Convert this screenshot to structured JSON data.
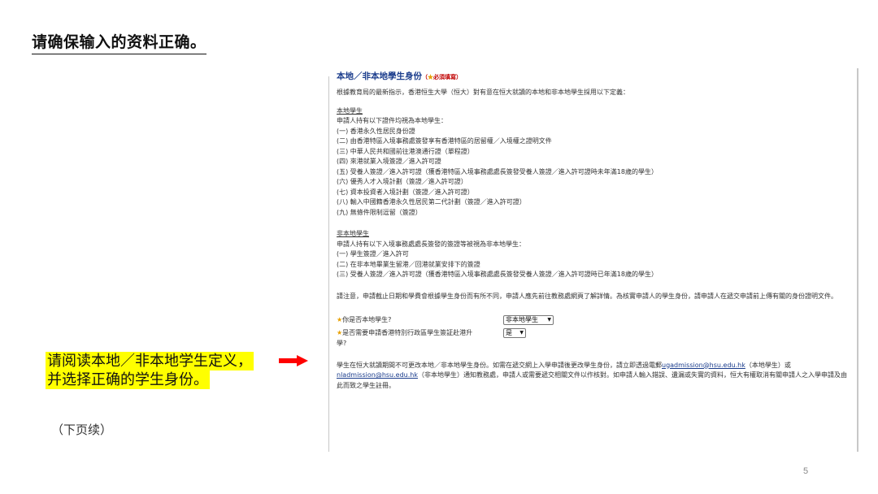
{
  "slide": {
    "title": "请确保输入的资料正确。",
    "instruction_lines": [
      "请阅读本地／非本地学生定义，",
      "并选择正确的学生身份。"
    ],
    "continued": "（下页续）",
    "page_number": "5",
    "arrow_color": "#ff0000",
    "highlight_color": "#ffff00"
  },
  "form": {
    "section_title": "本地／非本地學生身份",
    "required_note": "必須填寫",
    "intro": "根據教育局的最新指示，香港恒生大學（恒大）對有意在恒大就讀的本地和非本地學生採用以下定義：",
    "local": {
      "heading": "本地學生",
      "lead": "申請人持有以下證件均視為本地學生：",
      "items": [
        "(一) 香港永久性居民身份證",
        "(二) 由香港特區入境事務處簽發享有香港特區的居留權／入境權之證明文件",
        "(三) 中華人民共和國前往港澳通行證（單程證）",
        "(四) 來港就業入境簽證／進入許可證",
        "(五) 受養人簽證／進入許可證（獲香港特區入境事務處處長簽發受養人簽證／進入許可證時未年滿18歲的學生）",
        "(六) 優秀人才入境計劃（簽證／進入許可證）",
        "(七) 資本投資者入境計劃（簽證／進入許可證）",
        "(八) 輸入中國籍香港永久性居民第二代計劃（簽證／進入許可證）",
        "(九) 無條件限制逗留（簽證）"
      ]
    },
    "nonlocal": {
      "heading": "非本地學生",
      "lead": "申請人持有以下入境事務處處長簽發的簽證等被視為非本地學生：",
      "items": [
        "(一) 學生簽證／進入許可",
        "(二) 在非本地畢業生留港／回港就業安排下的簽證",
        "(三) 受養人簽證／進入許可證（獲香港特區入境事務處處長簽發受養人簽證／進入許可證時已年滿18歲的學生）"
      ]
    },
    "notice": "請注意，申請截止日期和學費會根據學生身份而有所不同，申請人應先前往教務處網頁了解詳情。為核實申請人的學生身份，請申請人在遞交申請前上傳有關的身份證明文件。",
    "q1": {
      "label": "你是否本地學生?",
      "value": "非本地學生"
    },
    "q2": {
      "label_line1": "是否需要申請香港特別行政區學生簽証赴港升",
      "label_line2": "學?",
      "value": "是"
    },
    "footer": {
      "part1": "學生在恒大就讀期間不可更改本地／非本地學生身份。如需在遞交網上入學申請後更改學生身份，請立即透過電郵",
      "email1": "ugadmission@hsu.edu.hk",
      "part2": "（本地學生）或",
      "email2": "nladmission@hsu.edu.hk",
      "part3": "（非本地學生）通知教務處，申請人或需要遞交相關文件以作核對。如申請人輸入錯誤、遺漏或失實的資料，恒大有權取消有關申請人之入學申請及由此而致之學生註冊。"
    }
  }
}
